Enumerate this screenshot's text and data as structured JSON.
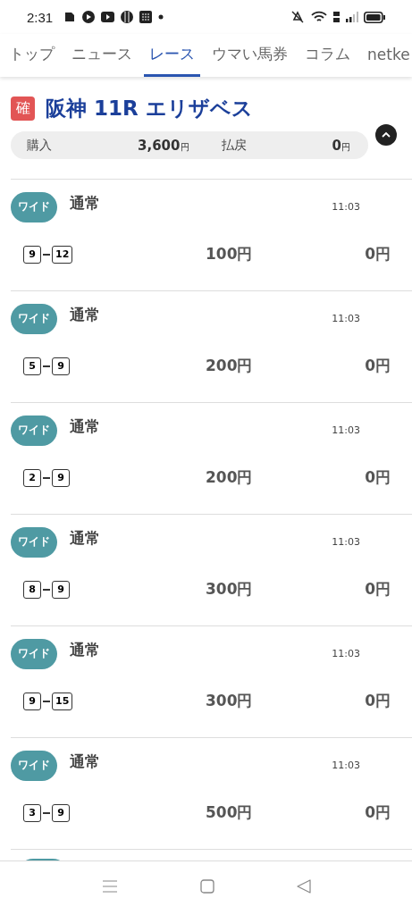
{
  "status_bar": {
    "time": "2:31"
  },
  "tabs": [
    {
      "label": "トップ",
      "selected": false
    },
    {
      "label": "ニュース",
      "selected": false
    },
    {
      "label": "レース",
      "selected": true
    },
    {
      "label": "ウマい馬券",
      "selected": false
    },
    {
      "label": "コラム",
      "selected": false
    },
    {
      "label": "netke",
      "selected": false
    }
  ],
  "race": {
    "badge": "確",
    "title": "阪神 11R エリザベス",
    "expanded": true,
    "summary": {
      "purchase_label": "購入",
      "purchase_amount": "3,600",
      "purchase_unit": "円",
      "payout_label": "払戻",
      "payout_amount": "0",
      "payout_unit": "円"
    }
  },
  "bets": [
    {
      "type": "ワイド",
      "method": "通常",
      "time": "11:03",
      "horses": [
        "9",
        "12"
      ],
      "stake": "100円",
      "payout": "0円"
    },
    {
      "type": "ワイド",
      "method": "通常",
      "time": "11:03",
      "horses": [
        "5",
        "9"
      ],
      "stake": "200円",
      "payout": "0円"
    },
    {
      "type": "ワイド",
      "method": "通常",
      "time": "11:03",
      "horses": [
        "2",
        "9"
      ],
      "stake": "200円",
      "payout": "0円"
    },
    {
      "type": "ワイド",
      "method": "通常",
      "time": "11:03",
      "horses": [
        "8",
        "9"
      ],
      "stake": "300円",
      "payout": "0円"
    },
    {
      "type": "ワイド",
      "method": "通常",
      "time": "11:03",
      "horses": [
        "9",
        "15"
      ],
      "stake": "300円",
      "payout": "0円"
    },
    {
      "type": "ワイド",
      "method": "通常",
      "time": "11:03",
      "horses": [
        "3",
        "9"
      ],
      "stake": "500円",
      "payout": "0円"
    }
  ]
}
